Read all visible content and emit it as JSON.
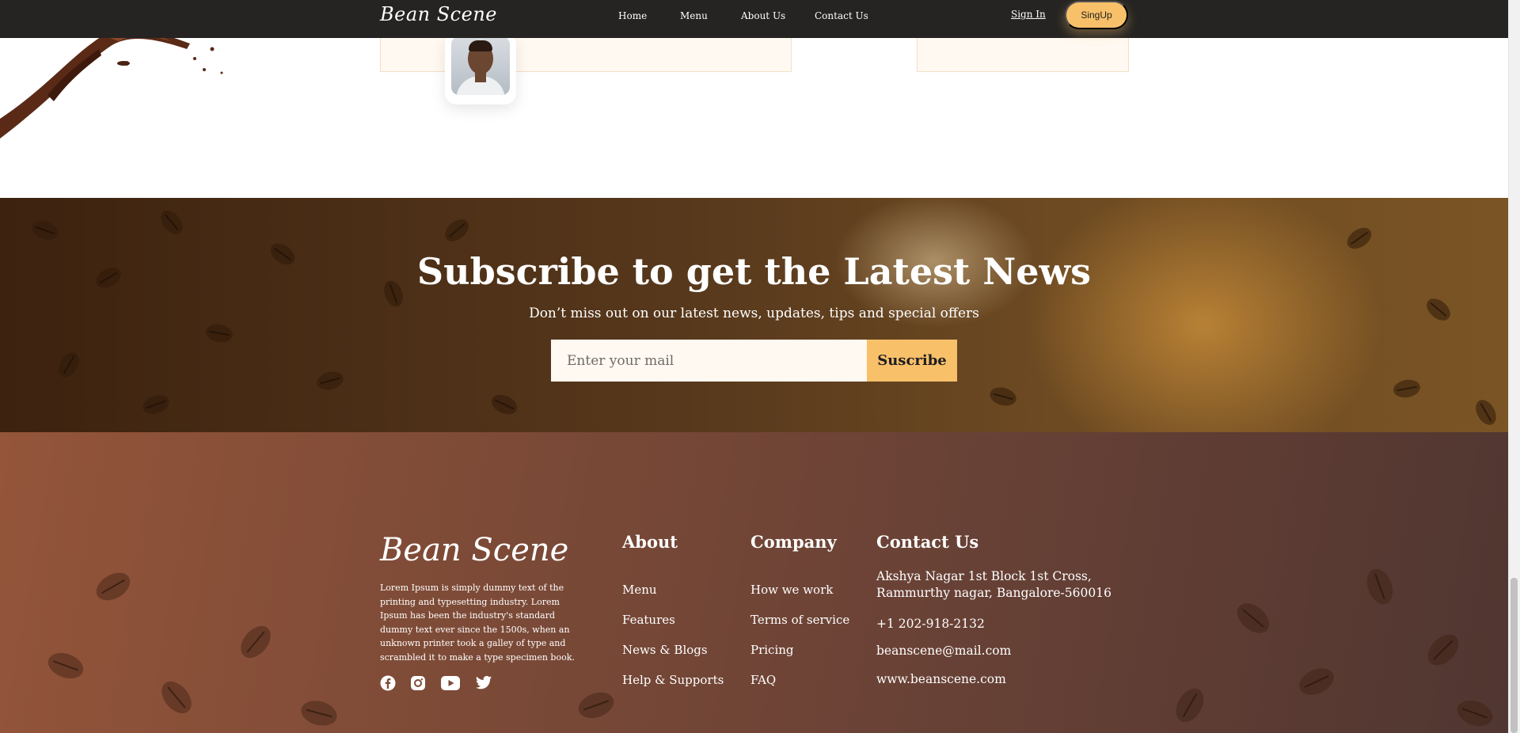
{
  "nav": {
    "logo": "Bean Scene",
    "links": [
      "Home",
      "Menu",
      "About Us",
      "Contact Us"
    ],
    "signin": "Sign In",
    "signup": "SingUp"
  },
  "subscribe": {
    "title": "Subscribe to get the Latest News",
    "text": "Don’t miss out on our latest news, updates, tips and special offers",
    "placeholder": "Enter your mail",
    "button": "Suscribe"
  },
  "footer": {
    "logo": "Bean Scene",
    "description": "Lorem Ipsum is simply dummy text of the printing and typesetting industry. Lorem Ipsum has been the industry's standard dummy text ever since the 1500s, when an unknown printer took a galley of type and scrambled it to make a type specimen book.",
    "socials": [
      "facebook-icon",
      "instagram-icon",
      "youtube-icon",
      "twitter-icon"
    ],
    "about": {
      "title": "About",
      "links": [
        "Menu",
        "Features",
        "News & Blogs",
        "Help & Supports"
      ]
    },
    "company": {
      "title": "Company",
      "links": [
        "How we work",
        "Terms of service",
        "Pricing",
        "FAQ"
      ]
    },
    "contact": {
      "title": "Contact Us",
      "address": "Akshya Nagar 1st Block 1st Cross, Rammurthy nagar, Bangalore-560016",
      "phone": "+1 202-918-2132",
      "email": "beanscene@mail.com",
      "website": "www.beanscene.com"
    }
  },
  "colors": {
    "accent": "#f9c06a",
    "navbar": "#252422",
    "card": "#fff9f1"
  }
}
